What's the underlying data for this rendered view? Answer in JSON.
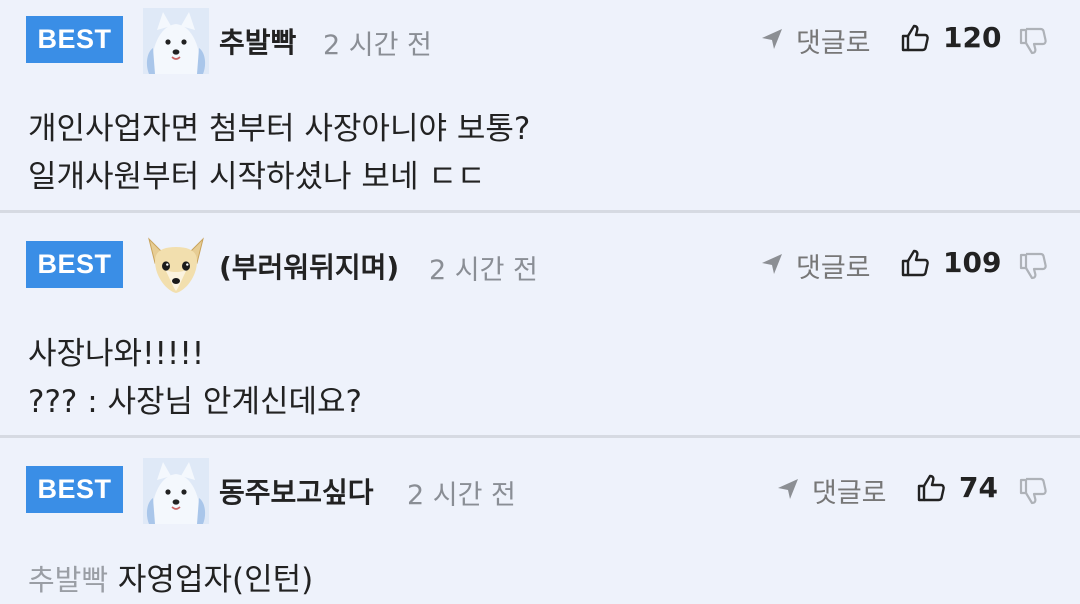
{
  "comments": [
    {
      "badge": "BEST",
      "author": "추발빡",
      "time": "2 시간 전",
      "reply_label": "댓글로",
      "likes": "120",
      "avatar": "white-dog-avatar",
      "lines": [
        "개인사업자면 첨부터 사장아니야 보통?",
        "일개사원부터 시작하셨나 보네 ㄷㄷ"
      ]
    },
    {
      "badge": "BEST",
      "author": "(부러워뒤지며)",
      "time": "2 시간 전",
      "reply_label": "댓글로",
      "likes": "109",
      "avatar": "chihuahua-avatar",
      "lines": [
        "사장나와!!!!!",
        "??? : 사장님 안계신데요?"
      ]
    },
    {
      "badge": "BEST",
      "author": "동주보고싶다",
      "time": "2 시간 전",
      "reply_label": "댓글로",
      "likes": "74",
      "avatar": "white-dog-avatar",
      "mention": "추발빡",
      "lines": [
        "자영업자(인턴)"
      ]
    }
  ]
}
